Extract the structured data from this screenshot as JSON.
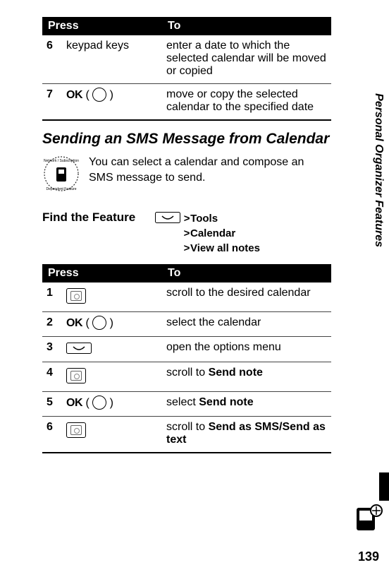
{
  "table1": {
    "head_press": "Press",
    "head_to": "To",
    "rows": [
      {
        "num": "6",
        "press": "keypad keys",
        "to": "enter a date to which the selected calendar will be moved or copied"
      },
      {
        "num": "7",
        "press_prefix": "OK",
        "to": "move or copy the selected calendar to the specified date"
      }
    ]
  },
  "section_title": "Sending an SMS Message from Calendar",
  "intro_text": "You can select a calendar and compose an SMS message to send.",
  "find": {
    "label": "Find the Feature",
    "path1": "Tools",
    "path2": "Calendar",
    "path3": "View all notes"
  },
  "table2": {
    "head_press": "Press",
    "head_to": "To",
    "rows": [
      {
        "num": "1",
        "to": "scroll to the desired calendar"
      },
      {
        "num": "2",
        "press_prefix": "OK",
        "to": "select the calendar"
      },
      {
        "num": "3",
        "to": "open the options menu"
      },
      {
        "num": "4",
        "to_prefix": "scroll to ",
        "to_bold": "Send note"
      },
      {
        "num": "5",
        "press_prefix": "OK",
        "to_prefix": "select ",
        "to_bold": "Send note"
      },
      {
        "num": "6",
        "to_prefix": "scroll to ",
        "to_bold": "Send as SMS/Send as text"
      }
    ]
  },
  "side_label": "Personal Organizer Features",
  "page_number": "139",
  "icons": {
    "ok_circle": "ok-circle-icon",
    "nav": "nav-pad-icon",
    "menu": "menu-key-icon",
    "network": "network-feature-icon",
    "pda": "pda-icon"
  }
}
